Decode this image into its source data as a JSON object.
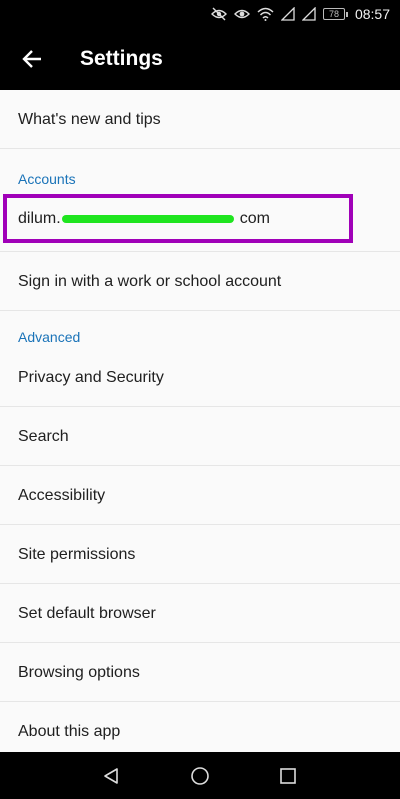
{
  "status_bar": {
    "battery": "78",
    "time": "08:57"
  },
  "app_bar": {
    "title": "Settings"
  },
  "settings": {
    "whats_new": "What's new and tips",
    "accounts_header": "Accounts",
    "account_prefix": "dilum.",
    "account_suffix": "com",
    "sign_in_work": "Sign in with a work or school account",
    "advanced_header": "Advanced",
    "privacy": "Privacy and Security",
    "search": "Search",
    "accessibility": "Accessibility",
    "site_permissions": "Site permissions",
    "default_browser": "Set default browser",
    "browsing_options": "Browsing options",
    "about": "About this app"
  },
  "colors": {
    "accent": "#1a73b8",
    "highlight": "#a000b8",
    "redaction": "#1fe51f"
  }
}
